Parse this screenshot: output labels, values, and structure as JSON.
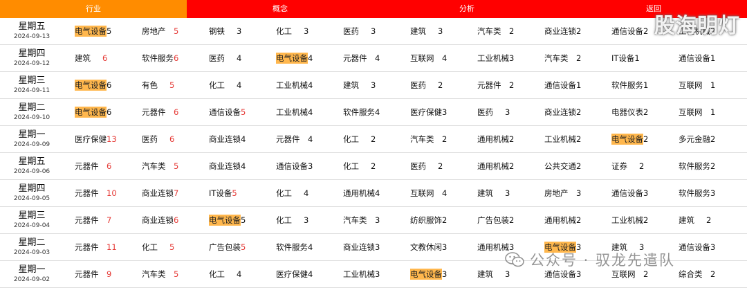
{
  "tabs": [
    "行业",
    "概念",
    "分析",
    "返回"
  ],
  "watermark": "股海明灯",
  "wechat_caption": "公众号 · 驭龙先遣队",
  "rows": [
    {
      "weekday": "星期五",
      "date": "2024-09-13",
      "cells": [
        {
          "name": "电气设备",
          "count": "5",
          "hl": true
        },
        {
          "name": "房地产",
          "count": "5",
          "red": true
        },
        {
          "name": "钢铁",
          "count": "3"
        },
        {
          "name": "化工",
          "count": "3"
        },
        {
          "name": "医药",
          "count": "3"
        },
        {
          "name": "建筑",
          "count": "3"
        },
        {
          "name": "汽车类",
          "count": "2"
        },
        {
          "name": "商业连锁",
          "count": "2"
        },
        {
          "name": "通信设备",
          "count": "2"
        },
        {
          "name": "工程机械",
          "count": "2"
        }
      ]
    },
    {
      "weekday": "星期四",
      "date": "2024-09-12",
      "cells": [
        {
          "name": "建筑",
          "count": "6",
          "red": true
        },
        {
          "name": "软件服务",
          "count": "6",
          "red": true
        },
        {
          "name": "医药",
          "count": "4"
        },
        {
          "name": "电气设备",
          "count": "4",
          "hl": true
        },
        {
          "name": "元器件",
          "count": "4"
        },
        {
          "name": "互联网",
          "count": "4"
        },
        {
          "name": "工业机械",
          "count": "3"
        },
        {
          "name": "汽车类",
          "count": "2"
        },
        {
          "name": "IT设备",
          "count": "1"
        },
        {
          "name": "通信设备",
          "count": "1"
        }
      ]
    },
    {
      "weekday": "星期三",
      "date": "2024-09-11",
      "cells": [
        {
          "name": "电气设备",
          "count": "6",
          "hl": true
        },
        {
          "name": "有色",
          "count": "5",
          "red": true
        },
        {
          "name": "化工",
          "count": "4"
        },
        {
          "name": "工业机械",
          "count": "4"
        },
        {
          "name": "建筑",
          "count": "3"
        },
        {
          "name": "医药",
          "count": "2"
        },
        {
          "name": "元器件",
          "count": "2"
        },
        {
          "name": "通信设备",
          "count": "1"
        },
        {
          "name": "软件服务",
          "count": "1"
        },
        {
          "name": "互联网",
          "count": "1"
        }
      ]
    },
    {
      "weekday": "星期二",
      "date": "2024-09-10",
      "cells": [
        {
          "name": "电气设备",
          "count": "6",
          "hl": true
        },
        {
          "name": "元器件",
          "count": "6",
          "red": true
        },
        {
          "name": "通信设备",
          "count": "5",
          "red": true
        },
        {
          "name": "工业机械",
          "count": "4"
        },
        {
          "name": "软件服务",
          "count": "4"
        },
        {
          "name": "医疗保健",
          "count": "3"
        },
        {
          "name": "医药",
          "count": "3"
        },
        {
          "name": "商业连锁",
          "count": "2"
        },
        {
          "name": "电器仪表",
          "count": "2"
        },
        {
          "name": "互联网",
          "count": "1"
        }
      ]
    },
    {
      "weekday": "星期一",
      "date": "2024-09-09",
      "cells": [
        {
          "name": "医疗保健",
          "count": "13",
          "red": true
        },
        {
          "name": "医药",
          "count": "6",
          "red": true
        },
        {
          "name": "商业连锁",
          "count": "4"
        },
        {
          "name": "元器件",
          "count": "4"
        },
        {
          "name": "化工",
          "count": "2"
        },
        {
          "name": "汽车类",
          "count": "2"
        },
        {
          "name": "通用机械",
          "count": "2"
        },
        {
          "name": "工业机械",
          "count": "2"
        },
        {
          "name": "电气设备",
          "count": "2",
          "hl": true
        },
        {
          "name": "多元金融",
          "count": "2"
        }
      ]
    },
    {
      "weekday": "星期五",
      "date": "2024-09-06",
      "cells": [
        {
          "name": "元器件",
          "count": "6",
          "red": true
        },
        {
          "name": "汽车类",
          "count": "5",
          "red": true
        },
        {
          "name": "商业连锁",
          "count": "4"
        },
        {
          "name": "通信设备",
          "count": "3"
        },
        {
          "name": "化工",
          "count": "2"
        },
        {
          "name": "医药",
          "count": "2"
        },
        {
          "name": "通用机械",
          "count": "2"
        },
        {
          "name": "公共交通",
          "count": "2"
        },
        {
          "name": "证券",
          "count": "2"
        },
        {
          "name": "软件服务",
          "count": "2"
        }
      ]
    },
    {
      "weekday": "星期四",
      "date": "2024-09-05",
      "cells": [
        {
          "name": "元器件",
          "count": "10",
          "red": true
        },
        {
          "name": "商业连锁",
          "count": "7",
          "red": true
        },
        {
          "name": "IT设备",
          "count": "5",
          "red": true
        },
        {
          "name": "化工",
          "count": "4"
        },
        {
          "name": "通用机械",
          "count": "4"
        },
        {
          "name": "互联网",
          "count": "4"
        },
        {
          "name": "建筑",
          "count": "3"
        },
        {
          "name": "房地产",
          "count": "3"
        },
        {
          "name": "通信设备",
          "count": "3"
        },
        {
          "name": "软件服务",
          "count": "3"
        }
      ]
    },
    {
      "weekday": "星期三",
      "date": "2024-09-04",
      "cells": [
        {
          "name": "元器件",
          "count": "7",
          "red": true
        },
        {
          "name": "商业连锁",
          "count": "6",
          "red": true
        },
        {
          "name": "电气设备",
          "count": "5",
          "hl": true
        },
        {
          "name": "化工",
          "count": "3"
        },
        {
          "name": "汽车类",
          "count": "3"
        },
        {
          "name": "纺织服饰",
          "count": "2"
        },
        {
          "name": "广告包装",
          "count": "2"
        },
        {
          "name": "通用机械",
          "count": "2"
        },
        {
          "name": "工业机械",
          "count": "2"
        },
        {
          "name": "建筑",
          "count": "2"
        }
      ]
    },
    {
      "weekday": "星期二",
      "date": "2024-09-03",
      "cells": [
        {
          "name": "元器件",
          "count": "11",
          "red": true
        },
        {
          "name": "化工",
          "count": "5",
          "red": true
        },
        {
          "name": "广告包装",
          "count": "5",
          "red": true
        },
        {
          "name": "软件服务",
          "count": "4"
        },
        {
          "name": "商业连锁",
          "count": "3"
        },
        {
          "name": "文教休闲",
          "count": "3"
        },
        {
          "name": "通用机械",
          "count": "3"
        },
        {
          "name": "电气设备",
          "count": "3",
          "hl": true
        },
        {
          "name": "建筑",
          "count": "3"
        },
        {
          "name": "通信设备",
          "count": "3"
        }
      ]
    },
    {
      "weekday": "星期一",
      "date": "2024-09-02",
      "cells": [
        {
          "name": "元器件",
          "count": "9",
          "red": true
        },
        {
          "name": "汽车类",
          "count": "5",
          "red": true
        },
        {
          "name": "化工",
          "count": "4"
        },
        {
          "name": "医疗保健",
          "count": "4"
        },
        {
          "name": "工业机械",
          "count": "3"
        },
        {
          "name": "电气设备",
          "count": "3",
          "hl": true
        },
        {
          "name": "建筑",
          "count": "3"
        },
        {
          "name": "通信设备",
          "count": "3"
        },
        {
          "name": "互联网",
          "count": "2"
        },
        {
          "name": "综合类",
          "count": "2"
        }
      ]
    }
  ]
}
